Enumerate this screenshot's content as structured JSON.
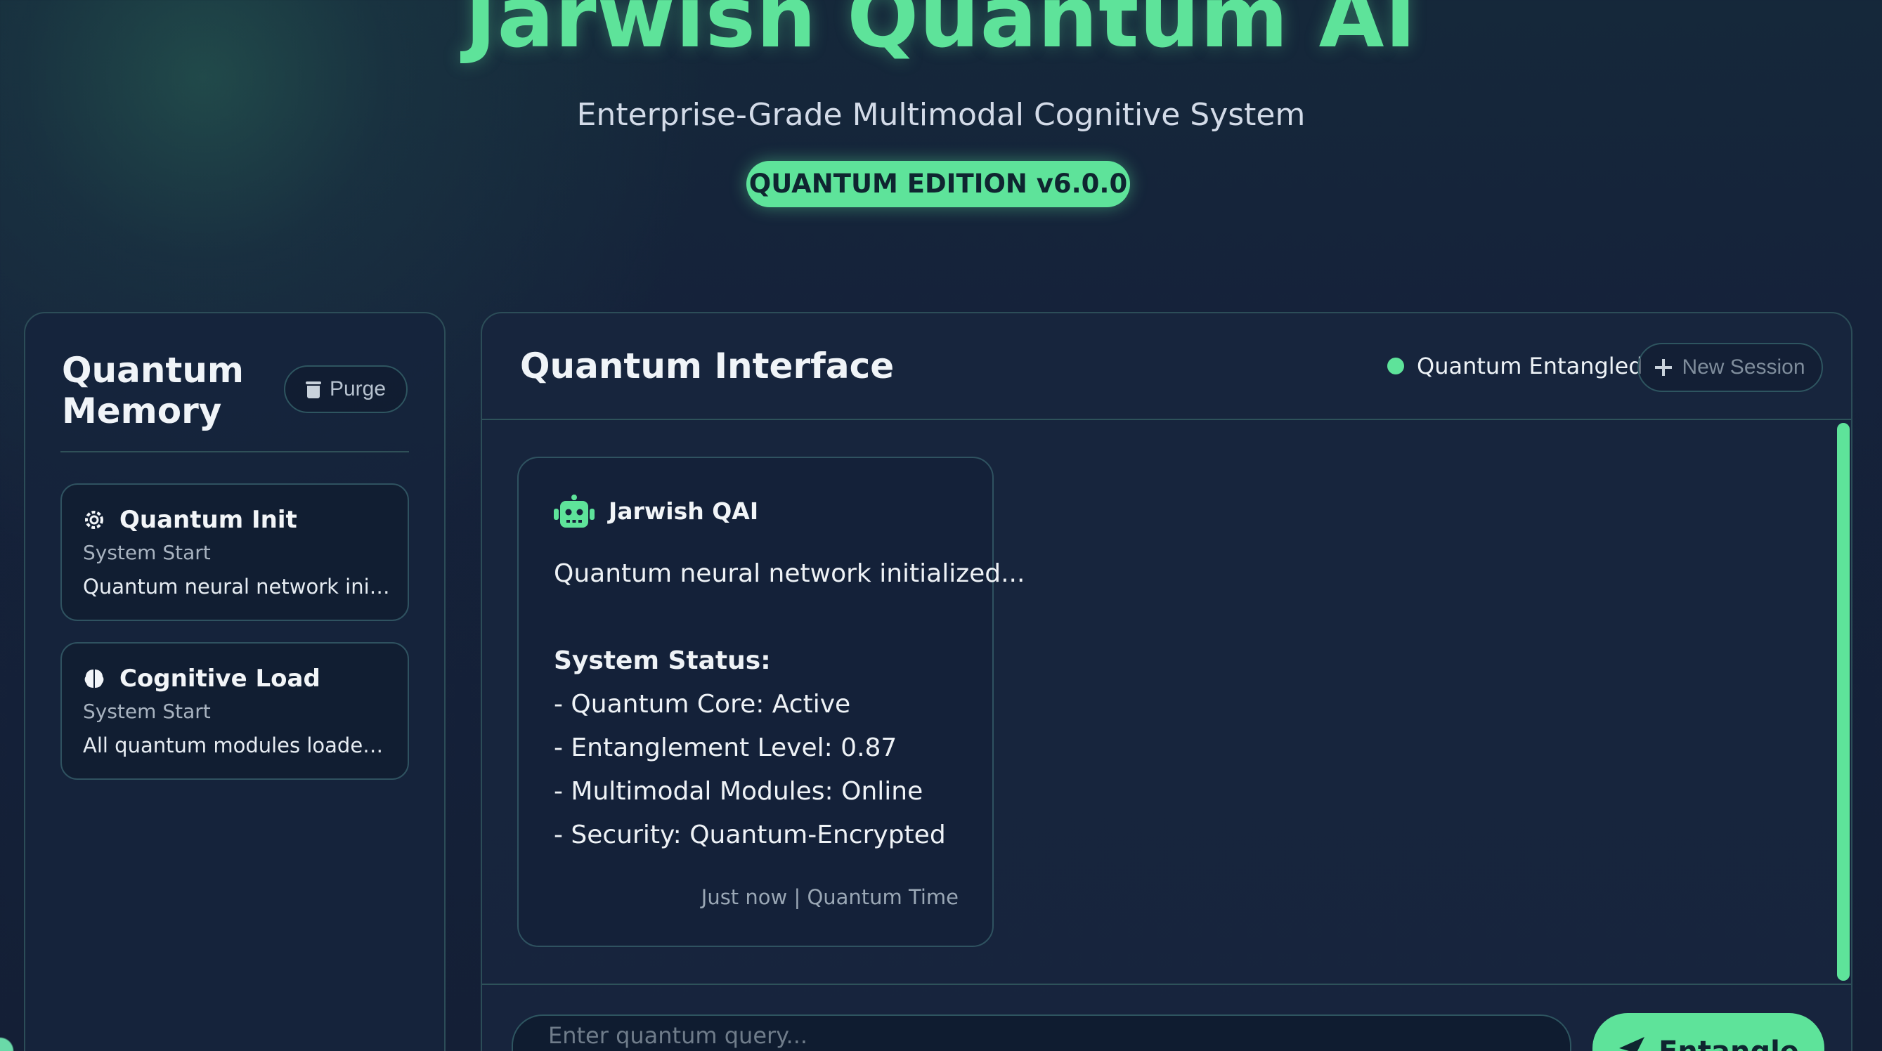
{
  "header": {
    "title": "Jarwish Quantum AI",
    "subtitle": "Enterprise-Grade Multimodal Cognitive System",
    "edition_badge": "QUANTUM EDITION v6.0.0"
  },
  "sidebar": {
    "title": "Quantum Memory",
    "purge_label": "Purge",
    "items": [
      {
        "icon": "atom-gear-icon",
        "title": "Quantum Init",
        "subtitle": "System Start",
        "preview": "Quantum neural network initiali..."
      },
      {
        "icon": "brain-icon",
        "title": "Cognitive Load",
        "subtitle": "System Start",
        "preview": "All quantum modules loaded su..."
      }
    ]
  },
  "chat": {
    "title": "Quantum Interface",
    "status": "Quantum Entangled",
    "status_color": "#5ee39a",
    "new_session_label": "New Session",
    "messages": [
      {
        "sender": "Jarwish QAI",
        "sender_icon": "robot-icon",
        "lines": [
          "Quantum neural network initialized...",
          "",
          "System Status:",
          "- Quantum Core: Active",
          "- Entanglement Level: 0.87",
          "- Multimodal Modules: Online",
          "- Security: Quantum-Encrypted"
        ],
        "meta": "Just now | Quantum Time"
      }
    ],
    "input_placeholder": "Enter quantum query...",
    "send_label": "Entangle",
    "send_icon": "paper-plane-icon"
  },
  "colors": {
    "accent": "#5ee39a",
    "background": "#15223a",
    "panel": "#17253e"
  }
}
